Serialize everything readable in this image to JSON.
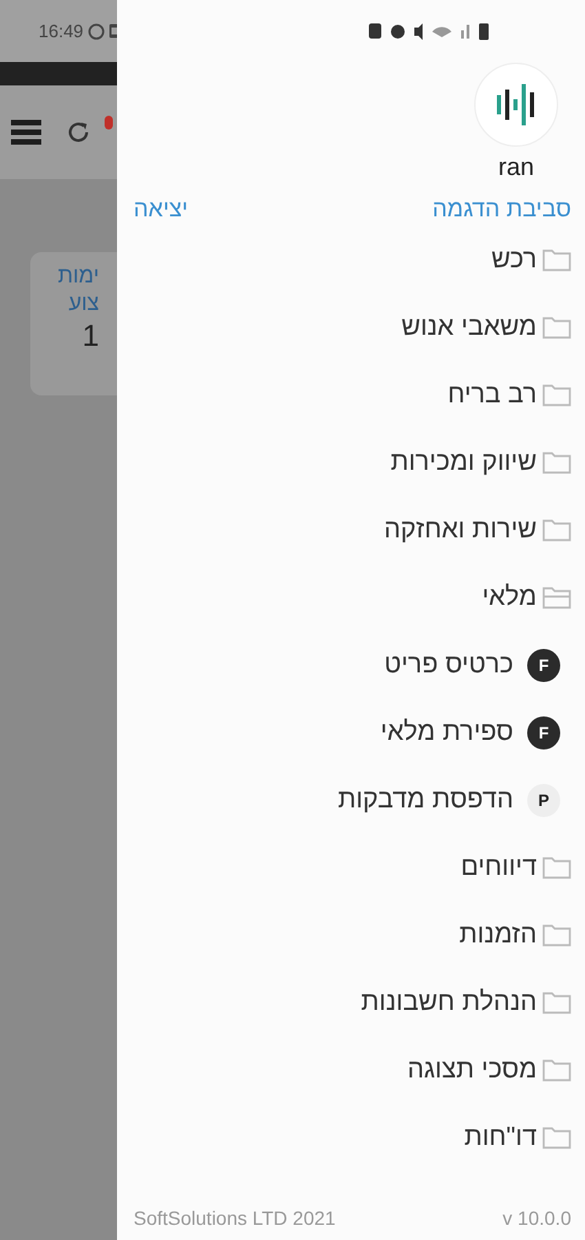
{
  "background": {
    "time": "16:49",
    "card": {
      "lines": [
        "ימות",
        "צוע"
      ],
      "value": "1"
    }
  },
  "drawer": {
    "user": "ran",
    "environment": "סביבת הדגמה",
    "logout": "יציאה",
    "menu": [
      {
        "label": "רכש",
        "kind": "folder",
        "expanded": false
      },
      {
        "label": "משאבי אנוש",
        "kind": "folder",
        "expanded": false
      },
      {
        "label": "רב בריח",
        "kind": "folder",
        "expanded": false
      },
      {
        "label": "שיווק ומכירות",
        "kind": "folder",
        "expanded": false
      },
      {
        "label": "שירות ואחזקה",
        "kind": "folder",
        "expanded": false
      },
      {
        "label": "מלאי",
        "kind": "folder",
        "expanded": true,
        "children": [
          {
            "label": "כרטיס פריט",
            "kind": "form",
            "badge": "F"
          },
          {
            "label": "ספירת מלאי",
            "kind": "form",
            "badge": "F"
          },
          {
            "label": "הדפסת מדבקות",
            "kind": "print",
            "badge": "P"
          }
        ]
      },
      {
        "label": "דיווחים",
        "kind": "folder",
        "expanded": false
      },
      {
        "label": "הזמנות",
        "kind": "folder",
        "expanded": false
      },
      {
        "label": "הנהלת חשבונות",
        "kind": "folder",
        "expanded": false
      },
      {
        "label": "מסכי תצוגה",
        "kind": "folder",
        "expanded": false
      },
      {
        "label": "דו\"חות",
        "kind": "folder",
        "expanded": false
      }
    ],
    "footer": {
      "company": "SoftSolutions LTD 2021",
      "version": "v 10.0.0"
    }
  }
}
